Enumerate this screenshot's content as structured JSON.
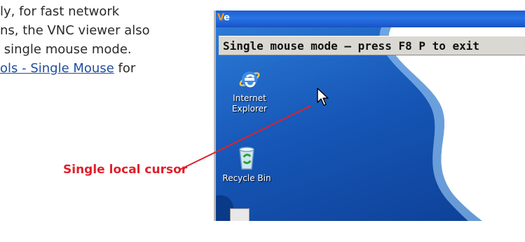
{
  "doc": {
    "lines": [
      "ly, for fast network",
      "ns, the VNC viewer also",
      " single mouse mode.",
      "ols - Single Mouse"
    ],
    "line4_suffix": " for"
  },
  "callout": {
    "label": "Single local cursor",
    "color": "#e0202a"
  },
  "window": {
    "logo_text": "V",
    "logo_text2": "e",
    "mode_banner": "Single mouse mode – press F8 P to exit"
  },
  "desktop": {
    "icons": [
      {
        "name": "internet-explorer",
        "label_line1": "Internet",
        "label_line2": "Explorer"
      },
      {
        "name": "recycle-bin",
        "label": "Recycle Bin"
      }
    ]
  },
  "colors": {
    "desktop_blue": "#1656b6",
    "banner_gray": "#d9d8d2",
    "link_blue": "#1f4e9e"
  }
}
